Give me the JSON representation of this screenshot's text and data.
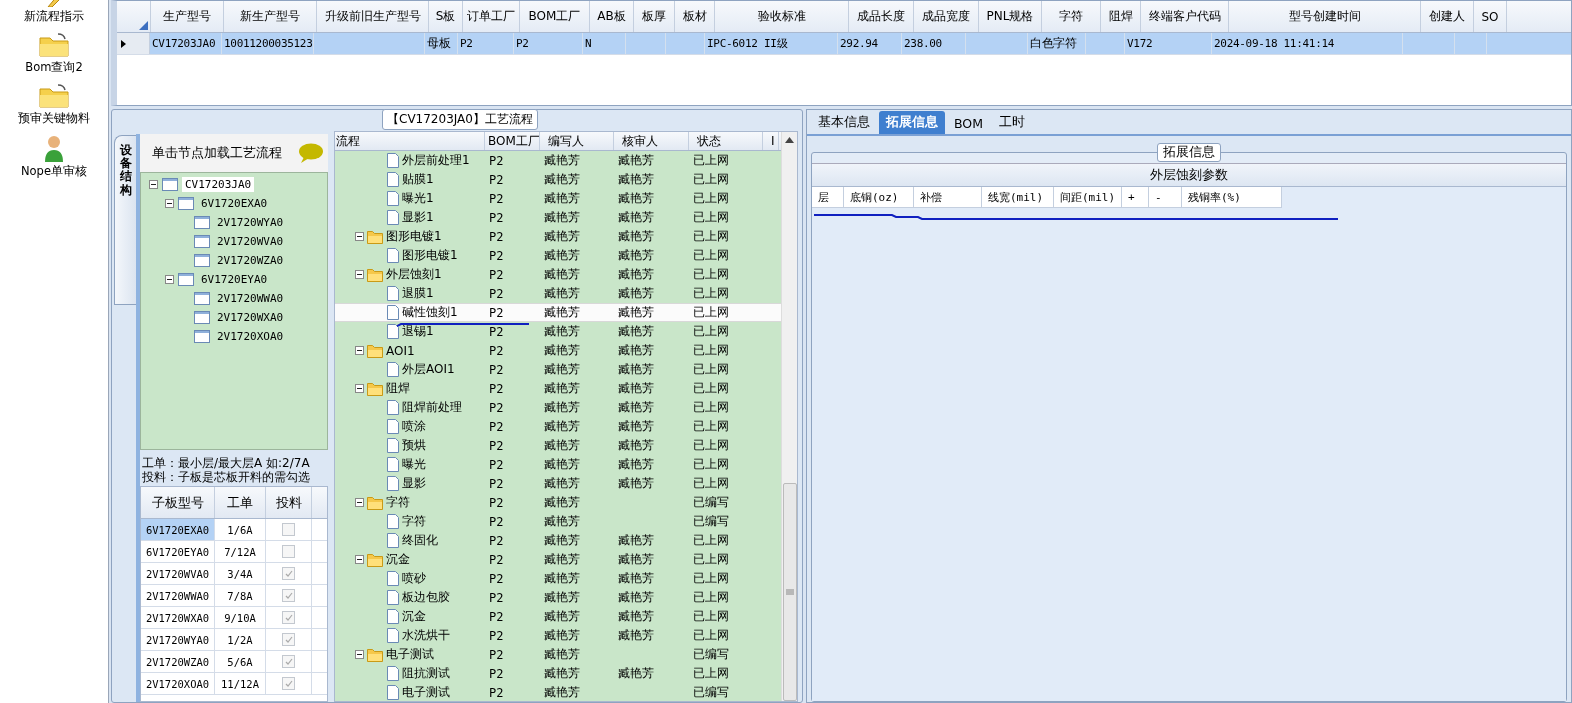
{
  "sidebar": {
    "items": [
      {
        "label": "新流程指示",
        "kind": "pen"
      },
      {
        "label": "Bom查询2",
        "kind": "folder"
      },
      {
        "label": "预审关键物料",
        "kind": "folder"
      },
      {
        "label": "Nope单审核",
        "kind": "person"
      }
    ]
  },
  "model_grid": {
    "columns": [
      "生产型号",
      "新生产型号",
      "升级前旧生产型号",
      "S板",
      "订单工厂",
      "BOM工厂",
      "AB板",
      "板厚",
      "板材",
      "验收标准",
      "成品长度",
      "成品宽度",
      "PNL规格",
      "字符",
      "阻焊",
      "终端客户代码",
      "型号创建时间",
      "创建人",
      "SO"
    ],
    "rows": [
      {
        "selected": true,
        "cells": [
          "CV17203JA0",
          "10011200035123",
          "",
          "母板",
          "P2",
          "P2",
          "N",
          "",
          "",
          "IPC-6012 II级",
          "292.94",
          "238.00",
          "",
          "白色字符",
          "",
          "V172",
          "2024-09-18 11:41:14",
          "",
          ""
        ]
      }
    ]
  },
  "process_panel": {
    "title": "【CV17203JA0】工艺流程",
    "side_tab": "设备结构",
    "structure_header": "单击节点加载工艺流程",
    "structure_tree": [
      {
        "label": "CV17203JA0",
        "selected": true,
        "expanded": true,
        "children": [
          {
            "label": "6V1720EXA0",
            "selected": false,
            "expanded": true,
            "children": [
              {
                "label": "2V1720WYA0",
                "selected": false
              },
              {
                "label": "2V1720WVA0",
                "selected": false
              },
              {
                "label": "2V1720WZA0",
                "selected": false
              }
            ]
          },
          {
            "label": "6V1720EYA0",
            "selected": false,
            "expanded": true,
            "children": [
              {
                "label": "2V1720WWA0",
                "selected": false
              },
              {
                "label": "2V1720WXA0",
                "selected": false
              },
              {
                "label": "2V1720XOA0",
                "selected": false
              }
            ]
          }
        ]
      }
    ],
    "notes": [
      "工单：最小层/最大层A 如:2/7A",
      "投料：子板是芯板开料的需勾选"
    ],
    "sub_grid": {
      "columns": [
        "子板型号",
        "工单",
        "投料"
      ],
      "rows": [
        {
          "model": "6V1720EXA0",
          "order": "1/6A",
          "checked": false,
          "selected": true
        },
        {
          "model": "6V1720EYA0",
          "order": "7/12A",
          "checked": false,
          "selected": false
        },
        {
          "model": "2V1720WVA0",
          "order": "3/4A",
          "checked": true,
          "selected": false
        },
        {
          "model": "2V1720WWA0",
          "order": "7/8A",
          "checked": true,
          "selected": false
        },
        {
          "model": "2V1720WXA0",
          "order": "9/10A",
          "checked": true,
          "selected": false
        },
        {
          "model": "2V1720WYA0",
          "order": "1/2A",
          "checked": true,
          "selected": false
        },
        {
          "model": "2V1720WZA0",
          "order": "5/6A",
          "checked": true,
          "selected": false
        },
        {
          "model": "2V1720XOA0",
          "order": "11/12A",
          "checked": true,
          "selected": false
        }
      ]
    },
    "process_grid": {
      "columns": [
        "流程",
        "BOM工厂",
        "编写人",
        "核审人",
        "状态",
        "I"
      ],
      "rows": [
        {
          "kind": "file",
          "label": "外层前处理1",
          "factory": "P2",
          "writer": "臧艳芳",
          "reviewer": "臧艳芳",
          "status": "已上网",
          "selected": false
        },
        {
          "kind": "file",
          "label": "贴膜1",
          "factory": "P2",
          "writer": "臧艳芳",
          "reviewer": "臧艳芳",
          "status": "已上网",
          "selected": false
        },
        {
          "kind": "file",
          "label": "曝光1",
          "factory": "P2",
          "writer": "臧艳芳",
          "reviewer": "臧艳芳",
          "status": "已上网",
          "selected": false
        },
        {
          "kind": "file",
          "label": "显影1",
          "factory": "P2",
          "writer": "臧艳芳",
          "reviewer": "臧艳芳",
          "status": "已上网",
          "selected": false
        },
        {
          "kind": "folder",
          "label": "图形电镀1",
          "factory": "P2",
          "writer": "臧艳芳",
          "reviewer": "臧艳芳",
          "status": "已上网",
          "selected": false,
          "expanded": true,
          "children": [
            {
              "kind": "file",
              "label": "图形电镀1",
              "factory": "P2",
              "writer": "臧艳芳",
              "reviewer": "臧艳芳",
              "status": "已上网",
              "selected": false
            }
          ]
        },
        {
          "kind": "folder",
          "label": "外层蚀刻1",
          "factory": "P2",
          "writer": "臧艳芳",
          "reviewer": "臧艳芳",
          "status": "已上网",
          "selected": false,
          "expanded": true,
          "children": [
            {
              "kind": "file",
              "label": "退膜1",
              "factory": "P2",
              "writer": "臧艳芳",
              "reviewer": "臧艳芳",
              "status": "已上网",
              "selected": false
            },
            {
              "kind": "file",
              "label": "碱性蚀刻1",
              "factory": "P2",
              "writer": "臧艳芳",
              "reviewer": "臧艳芳",
              "status": "已上网",
              "selected": true
            },
            {
              "kind": "file",
              "label": "退锡1",
              "factory": "P2",
              "writer": "臧艳芳",
              "reviewer": "臧艳芳",
              "status": "已上网",
              "selected": false
            }
          ]
        },
        {
          "kind": "folder",
          "label": "AOI1",
          "factory": "P2",
          "writer": "臧艳芳",
          "reviewer": "臧艳芳",
          "status": "已上网",
          "selected": false,
          "expanded": true,
          "children": [
            {
              "kind": "file",
              "label": "外层AOI1",
              "factory": "P2",
              "writer": "臧艳芳",
              "reviewer": "臧艳芳",
              "status": "已上网",
              "selected": false
            }
          ]
        },
        {
          "kind": "folder",
          "label": "阻焊",
          "factory": "P2",
          "writer": "臧艳芳",
          "reviewer": "臧艳芳",
          "status": "已上网",
          "selected": false,
          "expanded": true,
          "children": [
            {
              "kind": "file",
              "label": "阻焊前处理",
              "factory": "P2",
              "writer": "臧艳芳",
              "reviewer": "臧艳芳",
              "status": "已上网",
              "selected": false
            },
            {
              "kind": "file",
              "label": "喷涂",
              "factory": "P2",
              "writer": "臧艳芳",
              "reviewer": "臧艳芳",
              "status": "已上网",
              "selected": false
            },
            {
              "kind": "file",
              "label": "预烘",
              "factory": "P2",
              "writer": "臧艳芳",
              "reviewer": "臧艳芳",
              "status": "已上网",
              "selected": false
            },
            {
              "kind": "file",
              "label": "曝光",
              "factory": "P2",
              "writer": "臧艳芳",
              "reviewer": "臧艳芳",
              "status": "已上网",
              "selected": false
            },
            {
              "kind": "file",
              "label": "显影",
              "factory": "P2",
              "writer": "臧艳芳",
              "reviewer": "臧艳芳",
              "status": "已上网",
              "selected": false
            }
          ]
        },
        {
          "kind": "folder",
          "label": "字符",
          "factory": "P2",
          "writer": "臧艳芳",
          "status": "已编写",
          "selected": false,
          "expanded": true,
          "children": [
            {
              "kind": "file",
              "label": "字符",
              "factory": "P2",
              "writer": "臧艳芳",
              "status": "已编写",
              "selected": false
            },
            {
              "kind": "file",
              "label": "终固化",
              "factory": "P2",
              "writer": "臧艳芳",
              "reviewer": "臧艳芳",
              "status": "已上网",
              "selected": false
            }
          ]
        },
        {
          "kind": "folder",
          "label": "沉金",
          "factory": "P2",
          "writer": "臧艳芳",
          "reviewer": "臧艳芳",
          "status": "已上网",
          "selected": false,
          "expanded": true,
          "children": [
            {
              "kind": "file",
              "label": "喷砂",
              "factory": "P2",
              "writer": "臧艳芳",
              "reviewer": "臧艳芳",
              "status": "已上网",
              "selected": false
            },
            {
              "kind": "file",
              "label": "板边包胶",
              "factory": "P2",
              "writer": "臧艳芳",
              "reviewer": "臧艳芳",
              "status": "已上网",
              "selected": false
            },
            {
              "kind": "file",
              "label": "沉金",
              "factory": "P2",
              "writer": "臧艳芳",
              "reviewer": "臧艳芳",
              "status": "已上网",
              "selected": false
            },
            {
              "kind": "file",
              "label": "水洗烘干",
              "factory": "P2",
              "writer": "臧艳芳",
              "reviewer": "臧艳芳",
              "status": "已上网",
              "selected": false
            }
          ]
        },
        {
          "kind": "folder",
          "label": "电子测试",
          "factory": "P2",
          "writer": "臧艳芳",
          "status": "已编写",
          "selected": false,
          "expanded": true,
          "children": [
            {
              "kind": "file",
              "label": "阻抗测试",
              "factory": "P2",
              "writer": "臧艳芳",
              "reviewer": "臧艳芳",
              "status": "已上网",
              "selected": false
            },
            {
              "kind": "file",
              "label": "电子测试",
              "factory": "P2",
              "writer": "臧艳芳",
              "status": "已编写",
              "selected": false
            }
          ]
        }
      ]
    }
  },
  "detail_panel": {
    "tabs": [
      {
        "label": "基本信息",
        "selected": false
      },
      {
        "label": "拓展信息",
        "selected": true
      },
      {
        "label": "BOM",
        "selected": false
      },
      {
        "label": "工时",
        "selected": false
      }
    ],
    "group_title": "拓展信息",
    "grid_title": "外层蚀刻参数",
    "columns": [
      "层",
      "底铜(oz)",
      "补偿",
      "线宽(mil)",
      "间距(mil)",
      "+",
      "-",
      "残铜率(%)"
    ]
  }
}
